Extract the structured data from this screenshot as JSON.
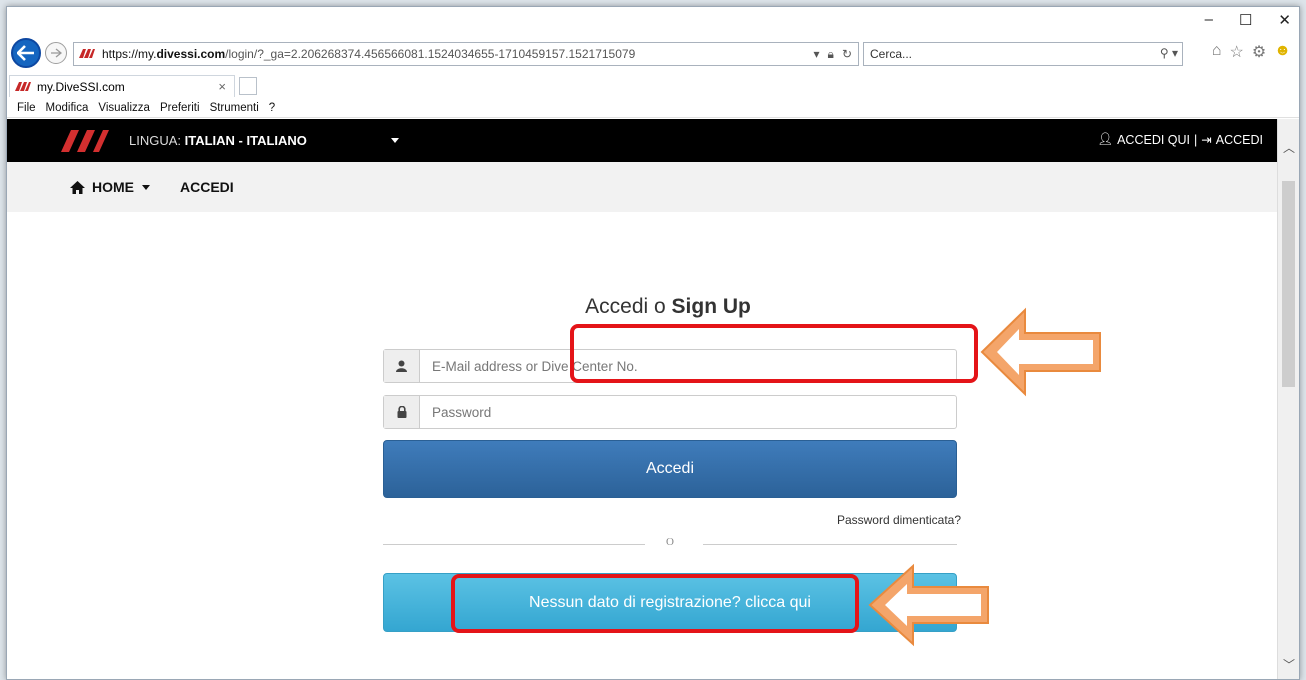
{
  "browser": {
    "url_protocol": "https://my.",
    "url_host": "divessi.com",
    "url_path": "/login/?_ga=2.206268374.456566081.1524034655-1710459157.1521715079",
    "search_placeholder": "Cerca...",
    "tab_title": "my.DiveSSI.com",
    "menu": [
      "File",
      "Modifica",
      "Visualizza",
      "Preferiti",
      "Strumenti",
      "?"
    ],
    "window_controls": [
      "–",
      "☐",
      "✕"
    ]
  },
  "site": {
    "logo_text": "SSI",
    "language_label": "LINGUA:",
    "language_value": "ITALIAN - ITALIANO",
    "accedi_qui": "ACCEDI QUI",
    "separator": "|",
    "accedi_right": "ACCEDI",
    "nav_home": "HOME",
    "nav_accedi": "ACCEDI"
  },
  "form": {
    "heading_prefix": "Accedi o ",
    "heading_bold": "Sign Up",
    "email_placeholder": "E-Mail address or Dive Center No.",
    "password_placeholder": "Password",
    "login_button": "Accedi",
    "forgot_link": "Password dimenticata?",
    "or_label": "O",
    "register_button": "Nessun dato di registrazione? clicca qui"
  },
  "colors": {
    "highlight": "#e41418",
    "arrow_fill": "#f4a56a",
    "primary_button": "#2c6299",
    "info_button": "#34a6d1"
  }
}
